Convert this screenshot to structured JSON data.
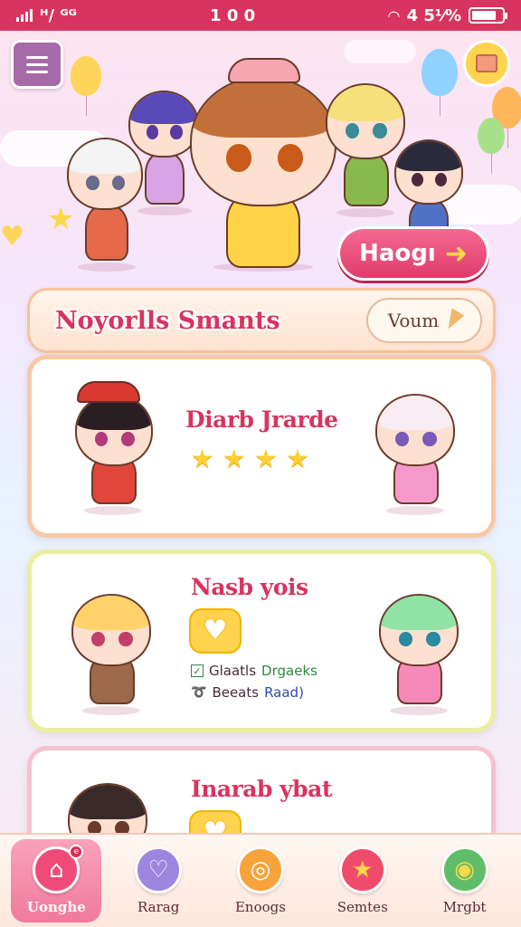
{
  "status_bar": {
    "carrier": "ᴴ/ ᴳᴳ",
    "time": "1 0 0",
    "battery": "4 5⅟%",
    "battery_level": 0.8
  },
  "hero": {
    "play_label": "Haogı",
    "play_arrow": "➜"
  },
  "section": {
    "title": "Noyorlls Smants",
    "view_label": "Voum"
  },
  "cards": [
    {
      "title": "Diarb Jrarde",
      "stars": 4
    },
    {
      "title": "Nasb yois",
      "tags": [
        {
          "label": "Glaatls",
          "value": "Drgaeks"
        },
        {
          "label": "Beeats",
          "value": "Raad)"
        }
      ]
    },
    {
      "title": "Inarab ybat"
    }
  ],
  "nav": [
    {
      "label": "Uonghe",
      "icon": "home-icon",
      "badge": "e",
      "color": "#f04a78"
    },
    {
      "label": "Rarag",
      "icon": "heart-gem-icon",
      "color": "#9c86e0"
    },
    {
      "label": "Enoogs",
      "icon": "coin-icon",
      "color": "#f7a23b"
    },
    {
      "label": "Semtes",
      "icon": "star-icon",
      "color": "#ef4c6c"
    },
    {
      "label": "Mrgbt",
      "icon": "globe-icon",
      "color": "#5fbd6a"
    }
  ],
  "colors": {
    "accent": "#d8345f",
    "status_bar": "#d8345f",
    "star": "#ffcf33"
  }
}
